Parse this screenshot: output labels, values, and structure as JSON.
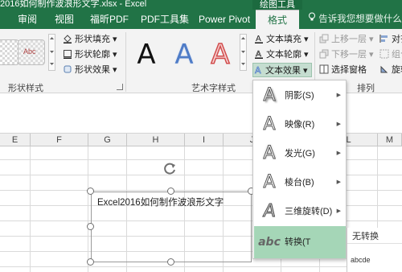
{
  "window": {
    "title": "2016如何制作波浪形文字.xlsx - Excel",
    "context_group": "绘图工具"
  },
  "tabs": [
    {
      "label": "审阅",
      "active": false
    },
    {
      "label": "视图",
      "active": false
    },
    {
      "label": "福昕PDF",
      "active": false
    },
    {
      "label": "PDF工具集",
      "active": false
    },
    {
      "label": "Power Pivot",
      "active": false
    },
    {
      "label": "格式",
      "active": true
    }
  ],
  "tell_me": {
    "placeholder": "告诉我您想要做什么..."
  },
  "ribbon": {
    "shape_styles": {
      "label": "形状样式",
      "fill": "形状填充",
      "outline": "形状轮廓",
      "effects": "形状效果",
      "gallery_sample": "Abc"
    },
    "wordart": {
      "label": "艺术字样式",
      "samples": [
        "A",
        "A",
        "A"
      ],
      "text_fill": "文本填充",
      "text_outline": "文本轮廓",
      "text_effects": "文本效果"
    },
    "arrange": {
      "label": "排列",
      "bring_forward": "上移一层",
      "send_backward": "下移一层",
      "selection_pane": "选择窗格",
      "align": "对齐",
      "group": "组合",
      "rotate": "旋转"
    }
  },
  "columns": [
    "E",
    "F",
    "G",
    "H",
    "I",
    "J",
    "K",
    "L",
    "M"
  ],
  "shape": {
    "text": "Excel2016如何制作波浪形文字"
  },
  "text_effects_menu": {
    "items": [
      {
        "label": "阴影(S)",
        "has_submenu": true,
        "highlighted": false
      },
      {
        "label": "映像(R)",
        "has_submenu": true,
        "highlighted": false
      },
      {
        "label": "发光(G)",
        "has_submenu": true,
        "highlighted": false
      },
      {
        "label": "棱台(B)",
        "has_submenu": true,
        "highlighted": false
      },
      {
        "label": "三维旋转(D)",
        "has_submenu": true,
        "highlighted": false
      },
      {
        "label": "转换(T",
        "has_submenu": true,
        "highlighted": true
      }
    ],
    "icon_glyph": "A",
    "transform_icon_text": "abc"
  },
  "transform_submenu": {
    "header": "无转换",
    "sample": "abcde"
  },
  "colors": {
    "excel_green": "#217346",
    "menu_highlight": "#a5d6b7"
  }
}
